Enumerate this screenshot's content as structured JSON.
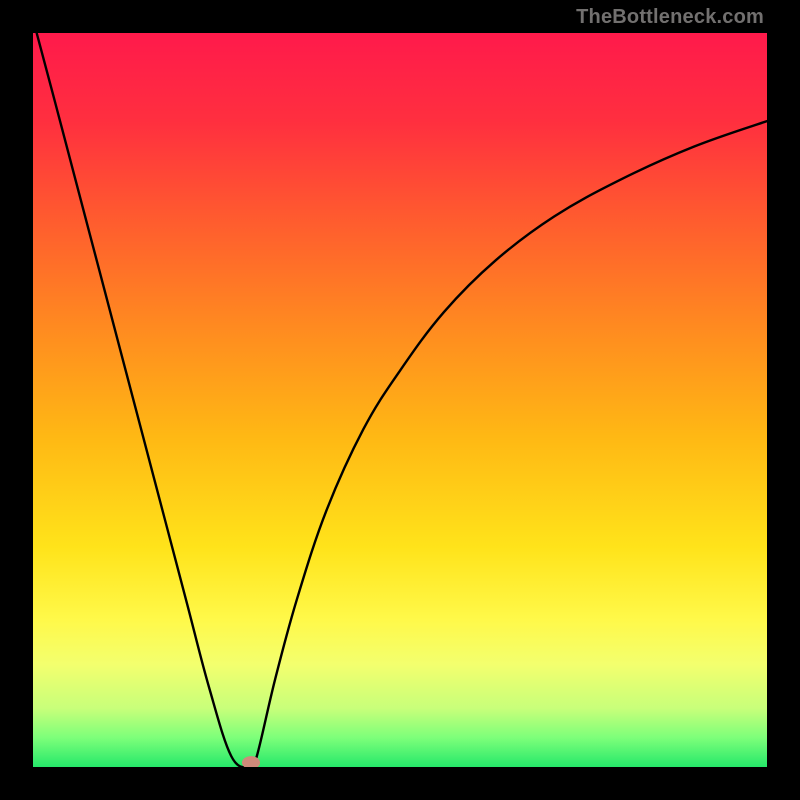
{
  "watermark": "TheBottleneck.com",
  "chart_data": {
    "type": "line",
    "title": "",
    "xlabel": "",
    "ylabel": "",
    "xlim": [
      0,
      100
    ],
    "ylim": [
      0,
      100
    ],
    "background_gradient": {
      "stops": [
        {
          "offset": 0.0,
          "color": "#ff1a4b"
        },
        {
          "offset": 0.12,
          "color": "#ff2f3f"
        },
        {
          "offset": 0.25,
          "color": "#ff5a2f"
        },
        {
          "offset": 0.4,
          "color": "#ff8a20"
        },
        {
          "offset": 0.55,
          "color": "#ffb814"
        },
        {
          "offset": 0.7,
          "color": "#ffe31a"
        },
        {
          "offset": 0.8,
          "color": "#fff94a"
        },
        {
          "offset": 0.86,
          "color": "#f3ff6e"
        },
        {
          "offset": 0.92,
          "color": "#c8ff7a"
        },
        {
          "offset": 0.96,
          "color": "#7dff7a"
        },
        {
          "offset": 1.0,
          "color": "#25e86a"
        }
      ]
    },
    "series": [
      {
        "name": "bottleneck-curve",
        "color": "#000000",
        "x": [
          0.5,
          3,
          6,
          9,
          12,
          15,
          18,
          21,
          24,
          27,
          29.5,
          30.5,
          33,
          36,
          40,
          45,
          50,
          56,
          63,
          71,
          80,
          90,
          100
        ],
        "y": [
          100,
          90.6,
          79.2,
          67.8,
          56.4,
          45.0,
          33.6,
          22.2,
          10.8,
          1.5,
          0.0,
          1.5,
          12.0,
          23.0,
          35.0,
          46.0,
          54.0,
          62.0,
          69.0,
          75.0,
          80.0,
          84.5,
          88.0
        ]
      }
    ],
    "marker": {
      "name": "minimum-marker",
      "x": 29.7,
      "y": 0.6,
      "color": "#cf8a7a"
    }
  }
}
